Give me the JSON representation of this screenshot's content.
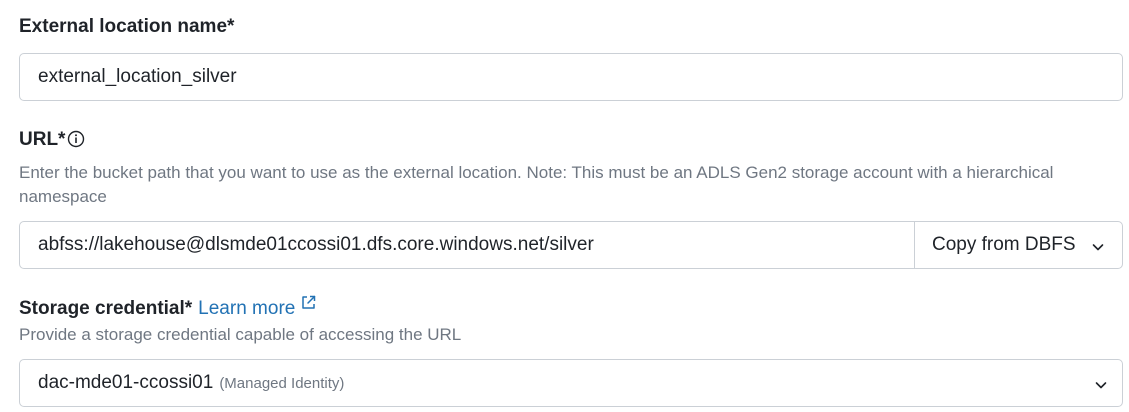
{
  "external_location": {
    "label": "External location name*",
    "value": "external_location_silver"
  },
  "url": {
    "label": "URL*",
    "info_icon": "info-circle-icon",
    "hint": "Enter the bucket path that you want to use as the external location. Note: This must be an ADLS Gen2 storage account with a hierarchical namespace",
    "value": "abfss://lakehouse@dlsmde01ccossi01.dfs.core.windows.net/silver",
    "copy_button_label": "Copy from DBFS",
    "copy_button_icon": "chevron-down-icon"
  },
  "storage_credential": {
    "label": "Storage credential*",
    "learn_more_label": "Learn more",
    "learn_more_icon": "external-link-icon",
    "hint": "Provide a storage credential capable of accessing the URL",
    "selected_value": "dac-mde01-ccossi01",
    "selected_value_note": "(Managed Identity)",
    "dropdown_icon": "chevron-down-icon"
  },
  "colors": {
    "link": "#2272b4",
    "border": "#cbd0d6",
    "hint_text": "#6f7782",
    "text": "#1f2329"
  }
}
